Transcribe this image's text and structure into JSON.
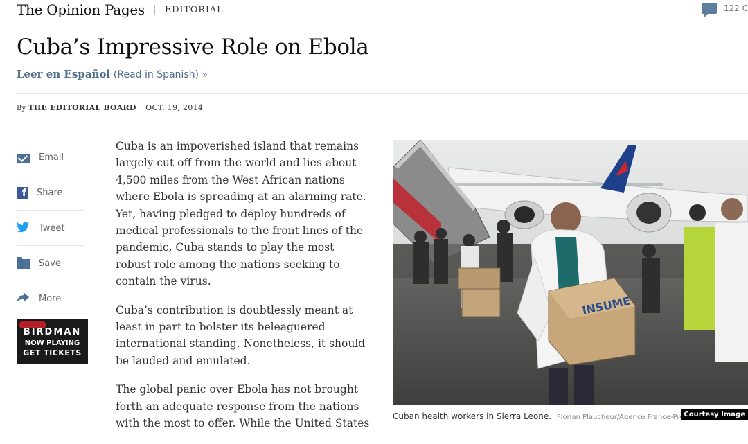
{
  "masthead": {
    "brand": "The Opinion Pages",
    "section": "EDITORIAL"
  },
  "comments": {
    "count": "122 C"
  },
  "article": {
    "headline": "Cuba’s Impressive Role on Ebola",
    "spanish_link": "Leer en Español",
    "spanish_paren": "(Read in Spanish) »",
    "byline_by": "By",
    "byline_author": "THE EDITORIAL BOARD",
    "byline_date": "OCT. 19, 2014",
    "paragraphs": [
      "Cuba is an impoverished island that remains largely cut off from the world and lies about 4,500 miles from the West African nations where Ebola is spreading at an alarming rate. Yet, having pledged to deploy hundreds of medical professionals to the front lines of the pandemic, Cuba stands to play the most robust role among the nations seeking to contain the virus.",
      "Cuba’s contribution is doubtlessly meant at least in part to bolster its beleaguered international standing. Nonetheless, it should be lauded and emulated.",
      "The global panic over Ebola has not brought forth an adequate response from the nations with the most to offer. While the United States"
    ]
  },
  "share_tools": [
    {
      "label": "Email",
      "icon": "email-icon"
    },
    {
      "label": "Share",
      "icon": "facebook-icon"
    },
    {
      "label": "Tweet",
      "icon": "twitter-icon"
    },
    {
      "label": "Save",
      "icon": "save-icon"
    },
    {
      "label": "More",
      "icon": "share-arrow-icon"
    }
  ],
  "ad": {
    "line1": "BIRDMAN",
    "line2": "NOW PLAYING",
    "line3": "GET TICKETS"
  },
  "photo": {
    "caption": "Cuban health workers in Sierra Leone.",
    "credit": "Florian Plaucheur/Agence France-Presse",
    "box_text": "INSUME"
  },
  "courtesy": "Courtesy Image"
}
